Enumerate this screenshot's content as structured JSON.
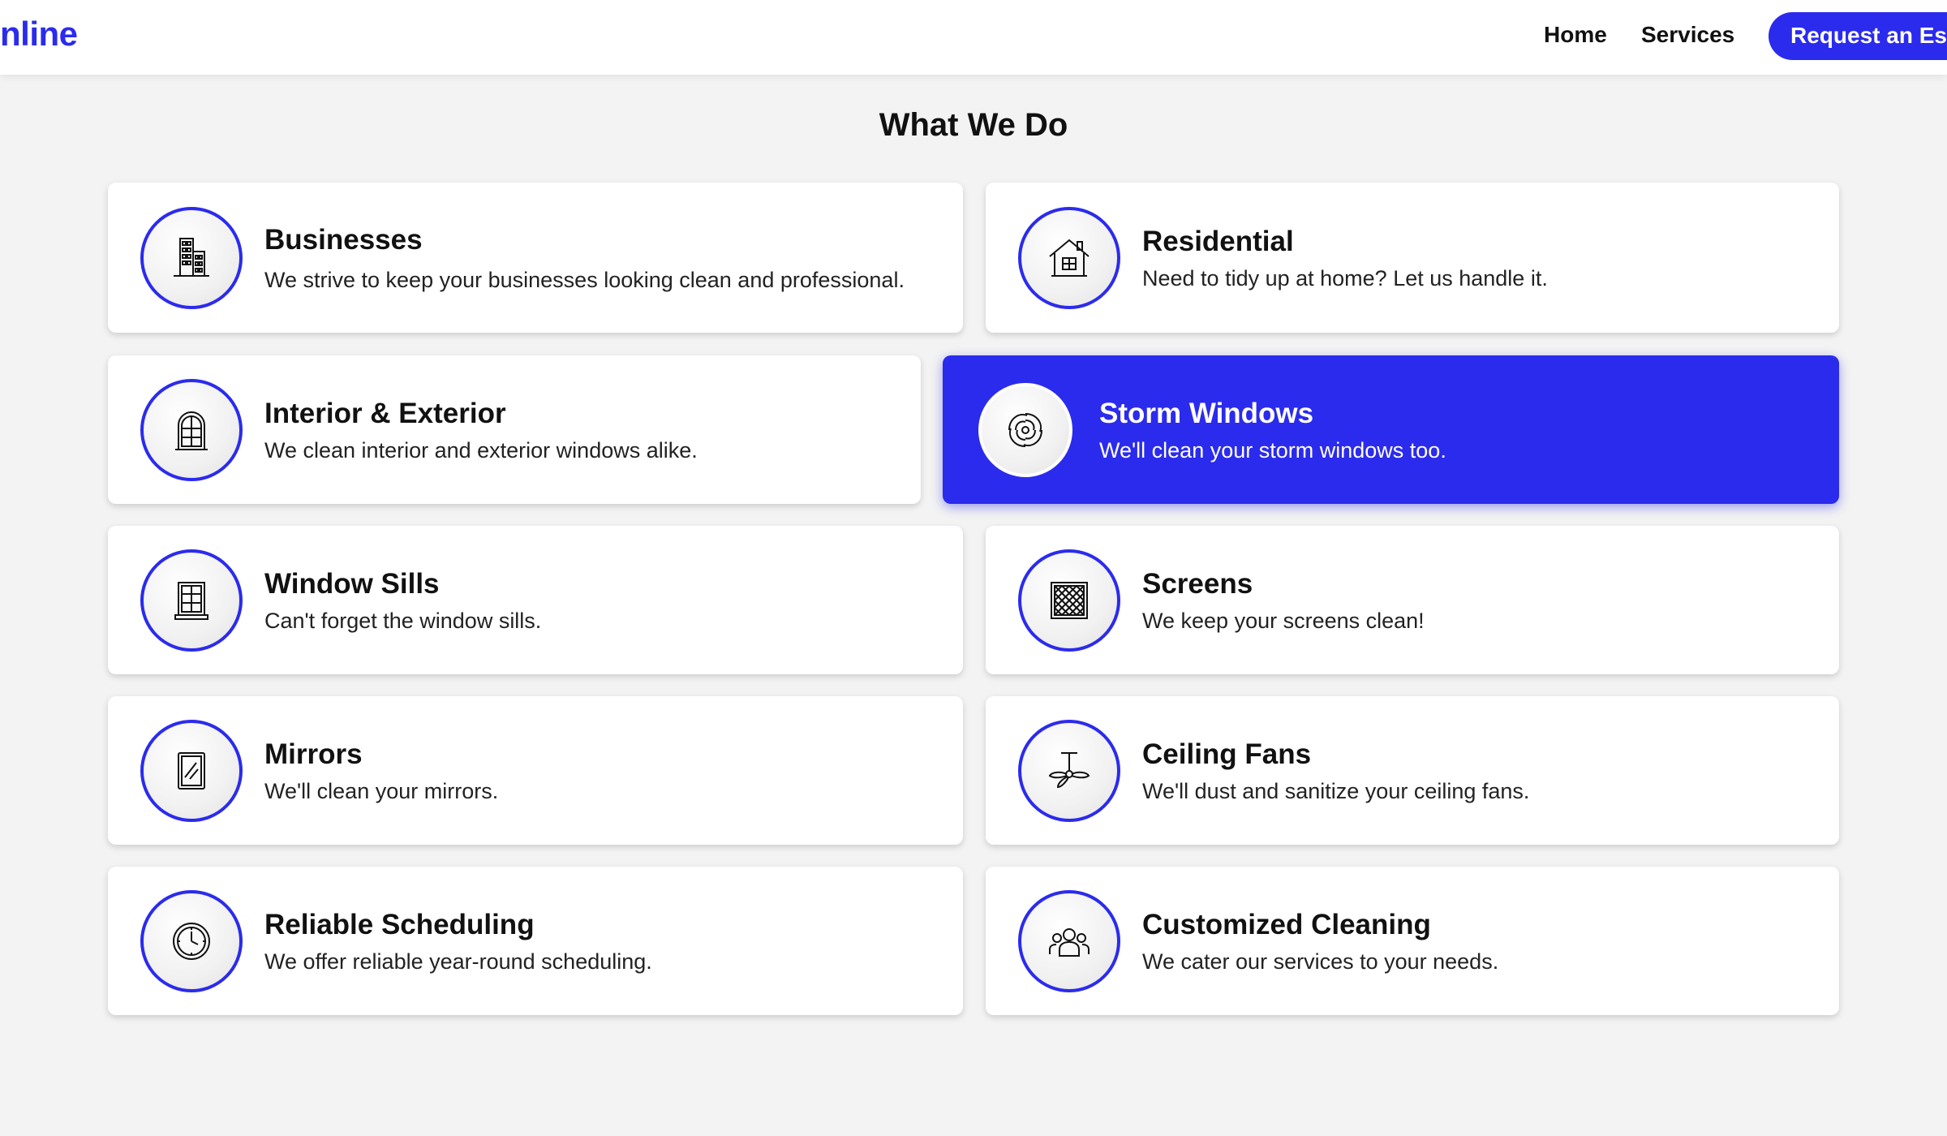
{
  "header": {
    "brand": "nline",
    "nav": {
      "home": "Home",
      "services": "Services"
    },
    "cta_label": "Request an Est"
  },
  "section": {
    "title": "What We Do"
  },
  "colors": {
    "accent": "#2b2bee",
    "background": "#f3f3f3",
    "card": "#ffffff"
  },
  "services": [
    {
      "title": "Businesses",
      "description": "We strive to keep your businesses looking clean and professional.",
      "icon": "building-icon"
    },
    {
      "title": "Residential",
      "description": "Need to tidy up at home? Let us handle it.",
      "icon": "house-icon"
    },
    {
      "title": "Interior & Exterior",
      "description": "We clean interior and exterior windows alike.",
      "icon": "arched-window-icon"
    },
    {
      "title": "Storm Windows",
      "description": "We'll clean your storm windows too.",
      "icon": "storm-swirl-icon",
      "selected": true
    },
    {
      "title": "Window Sills",
      "description": "Can't forget the window sills.",
      "icon": "window-sill-icon"
    },
    {
      "title": "Screens",
      "description": "We keep your screens clean!",
      "icon": "mesh-screen-icon"
    },
    {
      "title": "Mirrors",
      "description": "We'll clean your mirrors.",
      "icon": "mirror-icon"
    },
    {
      "title": "Ceiling Fans",
      "description": "We'll dust and sanitize your ceiling fans.",
      "icon": "ceiling-fan-icon"
    },
    {
      "title": "Reliable Scheduling",
      "description": "We offer reliable year-round scheduling.",
      "icon": "clock-icon"
    },
    {
      "title": "Customized Cleaning",
      "description": "We cater our services to your needs.",
      "icon": "people-group-icon"
    }
  ]
}
